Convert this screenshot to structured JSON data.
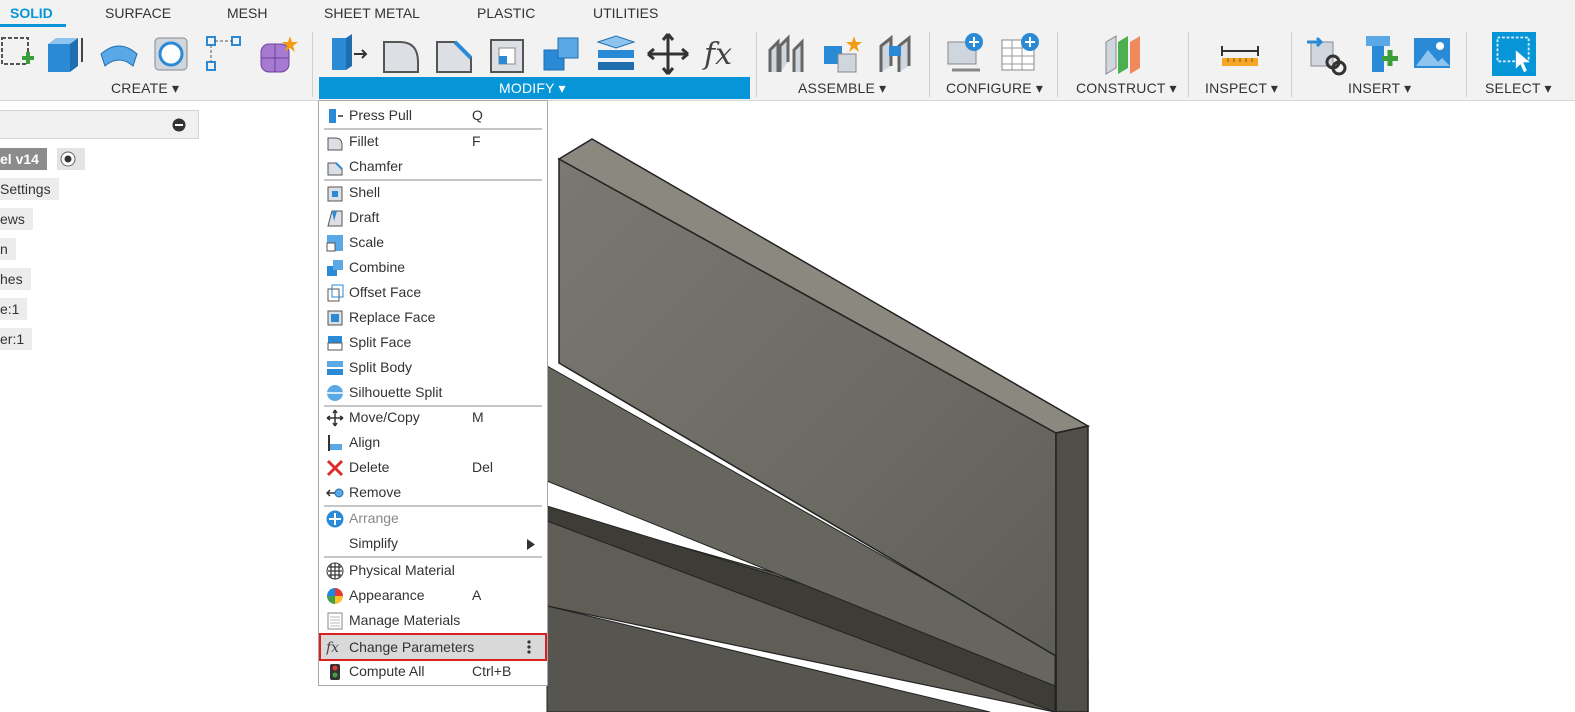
{
  "tabs": [
    "SOLID",
    "SURFACE",
    "MESH",
    "SHEET METAL",
    "PLASTIC",
    "UTILITIES"
  ],
  "active_tab": "SOLID",
  "toolbar": {
    "groups": {
      "create": "CREATE ▾",
      "modify": "MODIFY ▾",
      "assemble": "ASSEMBLE ▾",
      "configure": "CONFIGURE ▾",
      "construct": "CONSTRUCT ▾",
      "inspect": "INSPECT ▾",
      "insert": "INSERT ▾",
      "select": "SELECT ▾"
    },
    "fx_glyph": "fx",
    "accent_color": "#0696d7"
  },
  "browser": {
    "root": "el v14",
    "nodes": [
      "Settings",
      "ews",
      "n",
      "hes",
      "e:1",
      "er:1"
    ]
  },
  "menu": {
    "press_pull": {
      "label": "Press Pull",
      "key": "Q"
    },
    "fillet": {
      "label": "Fillet",
      "key": "F"
    },
    "chamfer": {
      "label": "Chamfer"
    },
    "shell": {
      "label": "Shell"
    },
    "draft": {
      "label": "Draft"
    },
    "scale": {
      "label": "Scale"
    },
    "combine": {
      "label": "Combine"
    },
    "offset_face": {
      "label": "Offset Face"
    },
    "replace_face": {
      "label": "Replace Face"
    },
    "split_face": {
      "label": "Split Face"
    },
    "split_body": {
      "label": "Split Body"
    },
    "silhouette_split": {
      "label": "Silhouette Split"
    },
    "move_copy": {
      "label": "Move/Copy",
      "key": "M"
    },
    "align": {
      "label": "Align"
    },
    "delete": {
      "label": "Delete",
      "key": "Del"
    },
    "remove": {
      "label": "Remove"
    },
    "arrange": {
      "label": "Arrange"
    },
    "simplify": {
      "label": "Simplify"
    },
    "physical_material": {
      "label": "Physical Material"
    },
    "appearance": {
      "label": "Appearance",
      "key": "A"
    },
    "manage_materials": {
      "label": "Manage Materials"
    },
    "change_parameters": {
      "label": "Change Parameters",
      "fx_glyph": "fx"
    },
    "compute_all": {
      "label": "Compute All",
      "key": "Ctrl+B"
    }
  },
  "highlight_color": "#d9201f"
}
